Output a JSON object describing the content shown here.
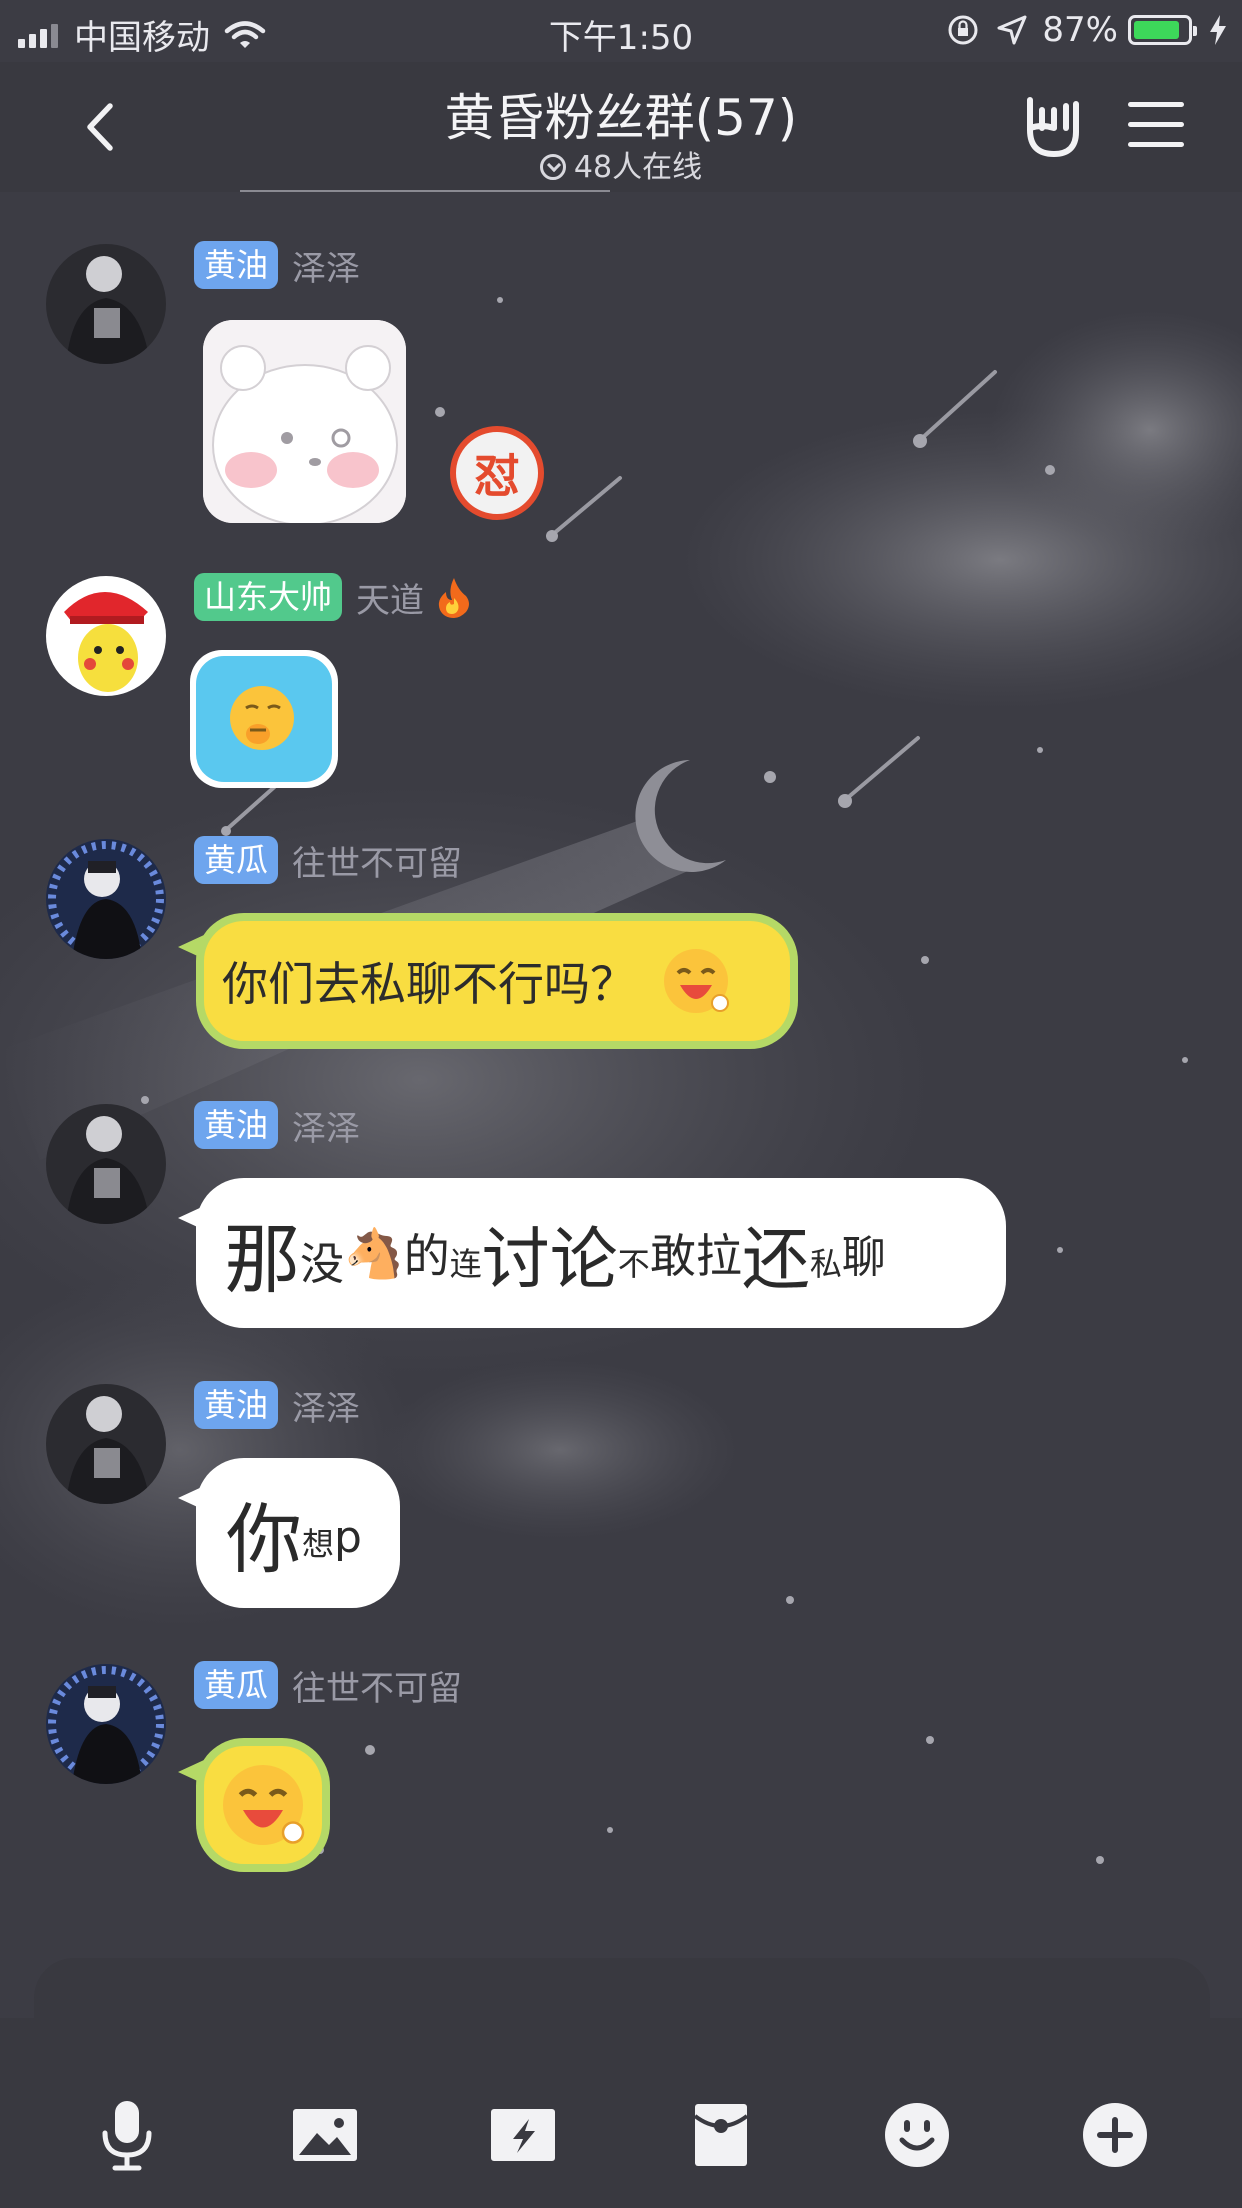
{
  "status_bar": {
    "carrier": "中国移动",
    "time": "下午1:50",
    "battery_percent": "87%",
    "battery_level": 0.87
  },
  "header": {
    "title": "黄昏粉丝群(57)",
    "online": "48人在线"
  },
  "messages": [
    {
      "badge": "黄油",
      "badge_color": "#6ea5ee",
      "sender": "泽泽",
      "type": "sticker",
      "reaction": "怼"
    },
    {
      "badge": "山东大帅",
      "badge_color": "#52c98c",
      "sender": "天道",
      "sender_icon": "fire-icon",
      "type": "emoji-sticker"
    },
    {
      "badge": "黄瓜",
      "badge_color": "#6ea5ee",
      "sender": "往世不可留",
      "type": "text",
      "text": "你们去私聊不行吗？"
    },
    {
      "badge": "黄油",
      "badge_color": "#6ea5ee",
      "sender": "泽泽",
      "type": "text",
      "segments": [
        "那",
        "没",
        "🐴",
        "的",
        "连",
        "讨论",
        "不",
        "敢拉",
        "还",
        "私",
        "聊"
      ]
    },
    {
      "badge": "黄油",
      "badge_color": "#6ea5ee",
      "sender": "泽泽",
      "type": "text",
      "segments": [
        "你",
        "想",
        "p"
      ]
    },
    {
      "badge": "黄瓜",
      "badge_color": "#6ea5ee",
      "sender": "往世不可留",
      "type": "sticker"
    }
  ],
  "toolbar": [
    "microphone-icon",
    "image-icon",
    "flash-photo-icon",
    "red-packet-icon",
    "emoji-icon",
    "plus-icon"
  ]
}
